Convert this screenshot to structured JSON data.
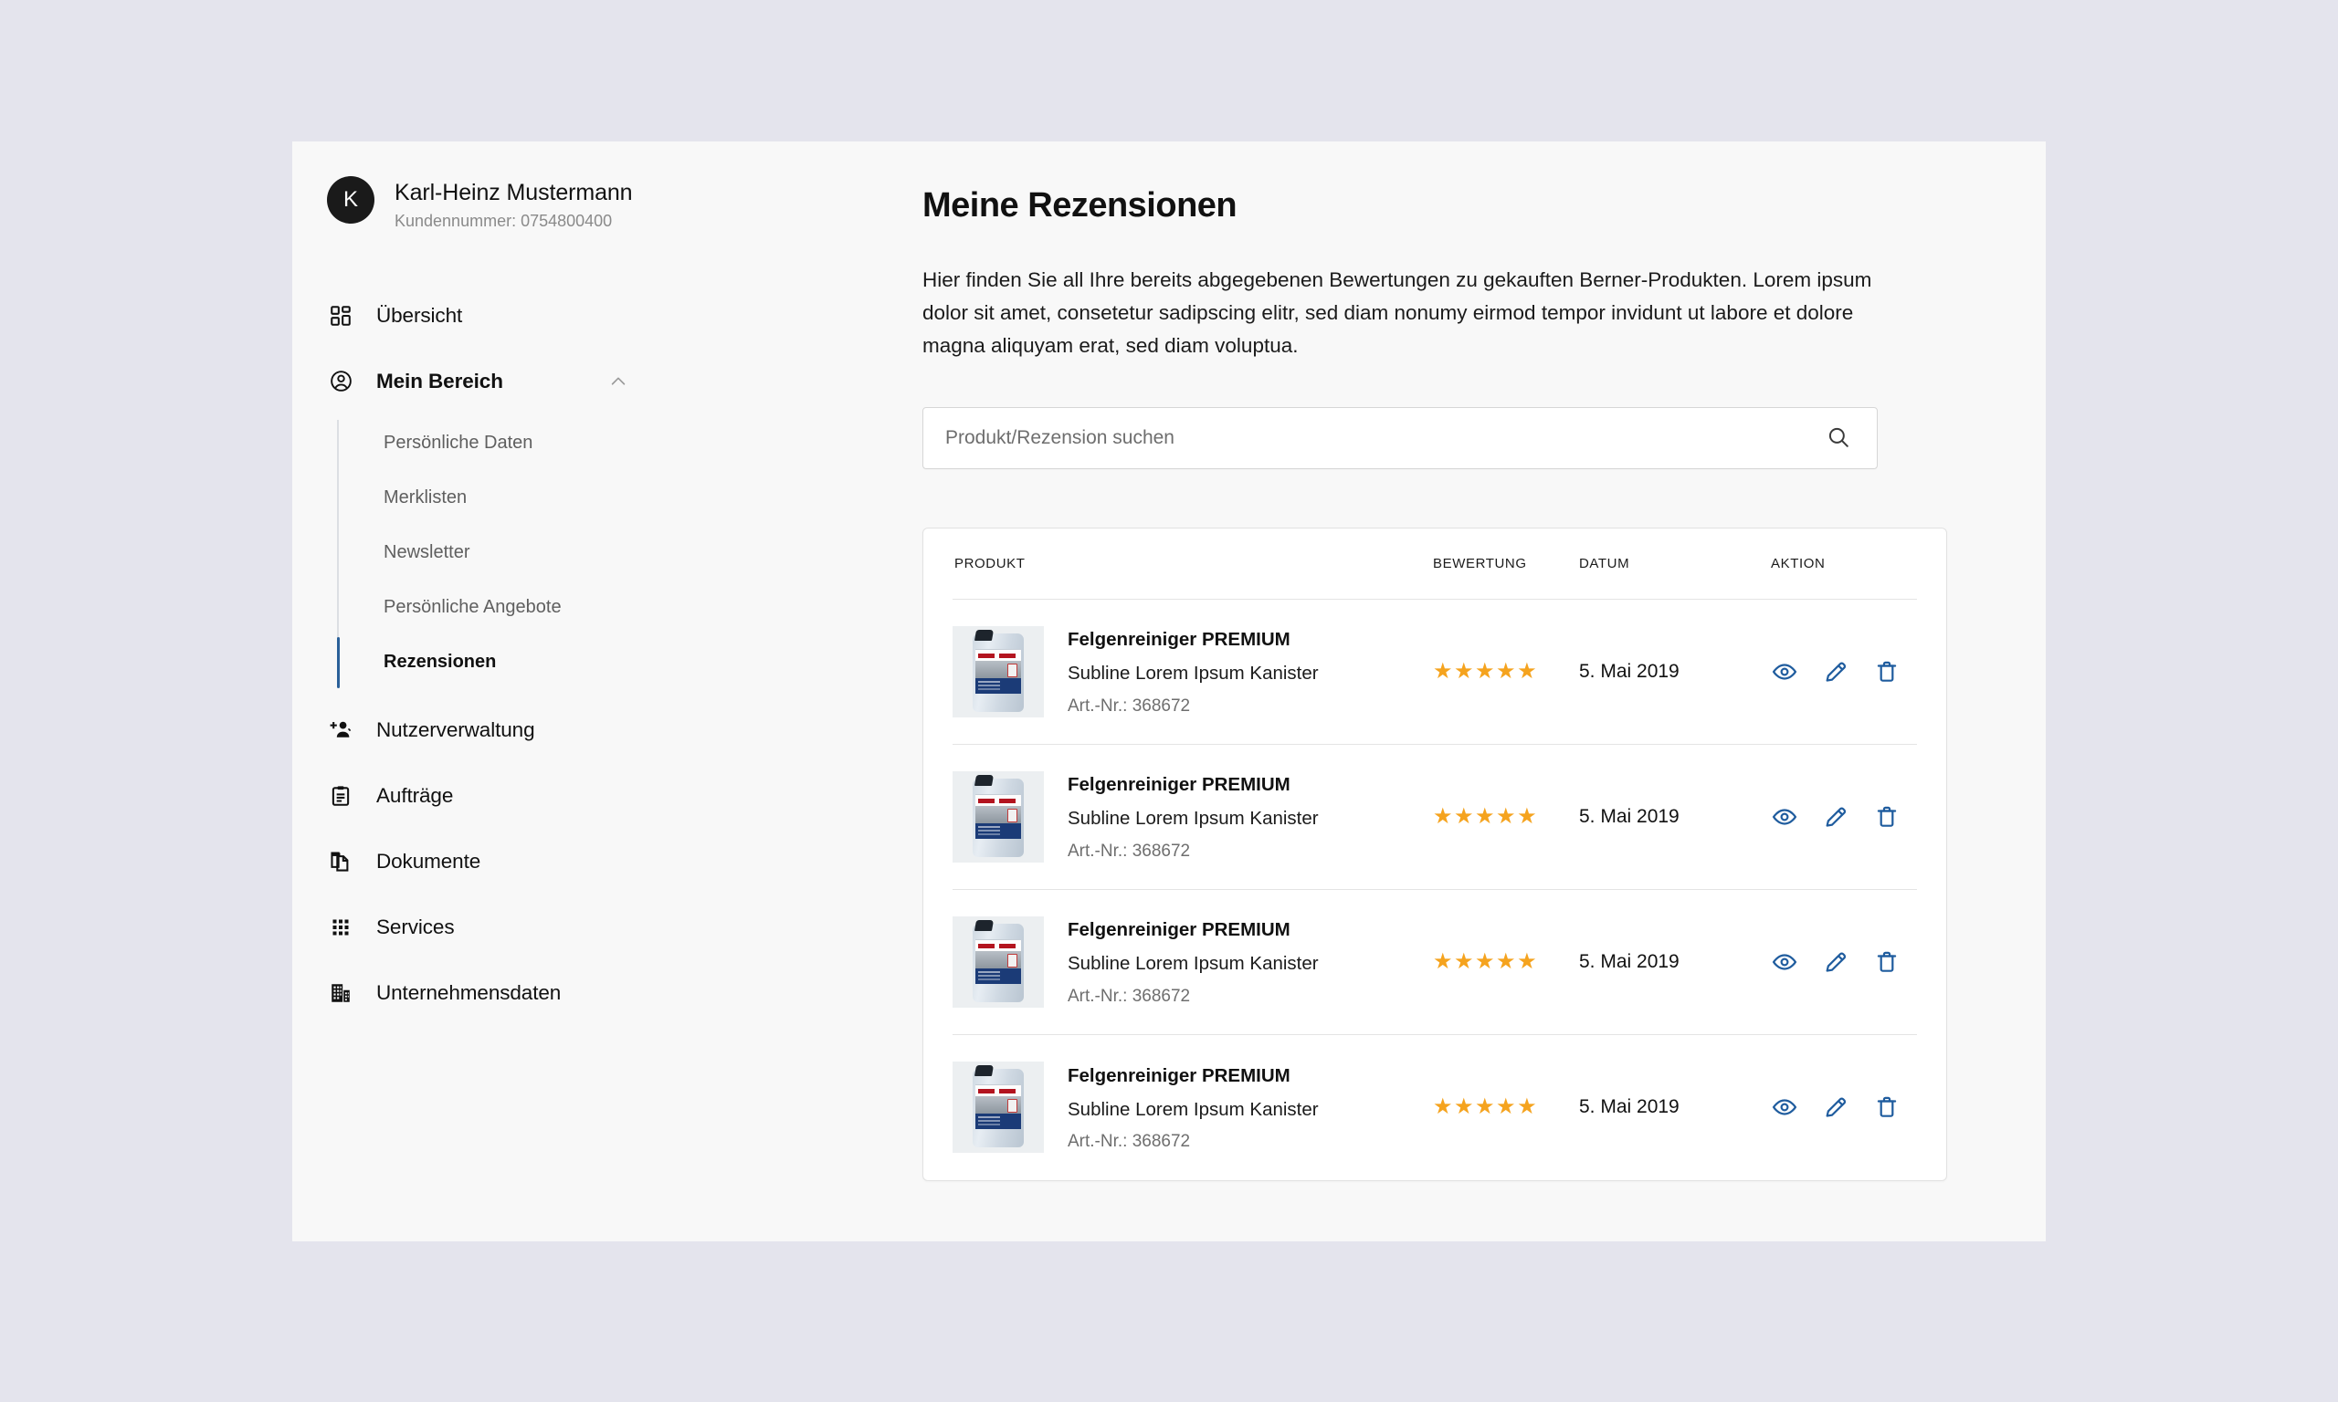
{
  "sidebar": {
    "user": {
      "avatar_initial": "K",
      "name": "Karl-Heinz Mustermann",
      "customer_number": "Kundennummer: 0754800400"
    },
    "items": [
      {
        "label": "Übersicht",
        "icon": "dashboard-grid-icon"
      },
      {
        "label": "Mein Bereich",
        "icon": "account-circle-icon",
        "expanded": true,
        "chevron": "chevron-up-icon"
      },
      {
        "label": "Nutzerverwaltung",
        "icon": "person-add-icon"
      },
      {
        "label": "Aufträge",
        "icon": "clipboard-icon"
      },
      {
        "label": "Dokumente",
        "icon": "documents-copy-icon"
      },
      {
        "label": "Services",
        "icon": "grid-dots-icon"
      },
      {
        "label": "Unternehmensdaten",
        "icon": "building-icon"
      }
    ],
    "subitems": [
      {
        "label": "Persönliche Daten",
        "active": false
      },
      {
        "label": "Merklisten",
        "active": false
      },
      {
        "label": "Newsletter",
        "active": false
      },
      {
        "label": "Persönliche Angebote",
        "active": false
      },
      {
        "label": "Rezensionen",
        "active": true
      }
    ],
    "active_indicator_color": "#2a6099"
  },
  "main": {
    "title": "Meine Rezensionen",
    "intro": "Hier finden Sie all Ihre bereits abgegebenen Bewertungen zu gekauften Berner-Produkten. Lorem ipsum dolor sit amet, consetetur sadipscing elitr, sed diam nonumy eirmod tempor invidunt ut labore et dolore magna aliquyam erat, sed diam voluptua.",
    "search": {
      "placeholder": "Produkt/Rezension suchen",
      "value": "",
      "icon": "search-icon"
    },
    "table": {
      "headers": {
        "produkt": "PRODUKT",
        "bewertung": "BEWERTUNG",
        "datum": "DATUM",
        "aktion": "AKTION"
      },
      "actions": {
        "view": "Ansehen",
        "edit": "Bearbeiten",
        "delete": "Löschen"
      },
      "star_color": "#f5a31e",
      "action_color": "#1f5c9e",
      "rows": [
        {
          "name": "Felgenreiniger PREMIUM",
          "subline": "Subline Lorem Ipsum Kanister",
          "article": "Art.-Nr.: 368672",
          "rating": 5,
          "stars": "★★★★★",
          "date": "5. Mai 2019"
        },
        {
          "name": "Felgenreiniger PREMIUM",
          "subline": "Subline Lorem Ipsum Kanister",
          "article": "Art.-Nr.: 368672",
          "rating": 5,
          "stars": "★★★★★",
          "date": "5. Mai 2019"
        },
        {
          "name": "Felgenreiniger PREMIUM",
          "subline": "Subline Lorem Ipsum Kanister",
          "article": "Art.-Nr.: 368672",
          "rating": 5,
          "stars": "★★★★★",
          "date": "5. Mai 2019"
        },
        {
          "name": "Felgenreiniger PREMIUM",
          "subline": "Subline Lorem Ipsum Kanister",
          "article": "Art.-Nr.: 368672",
          "rating": 5,
          "stars": "★★★★★",
          "date": "5. Mai 2019"
        }
      ]
    }
  }
}
